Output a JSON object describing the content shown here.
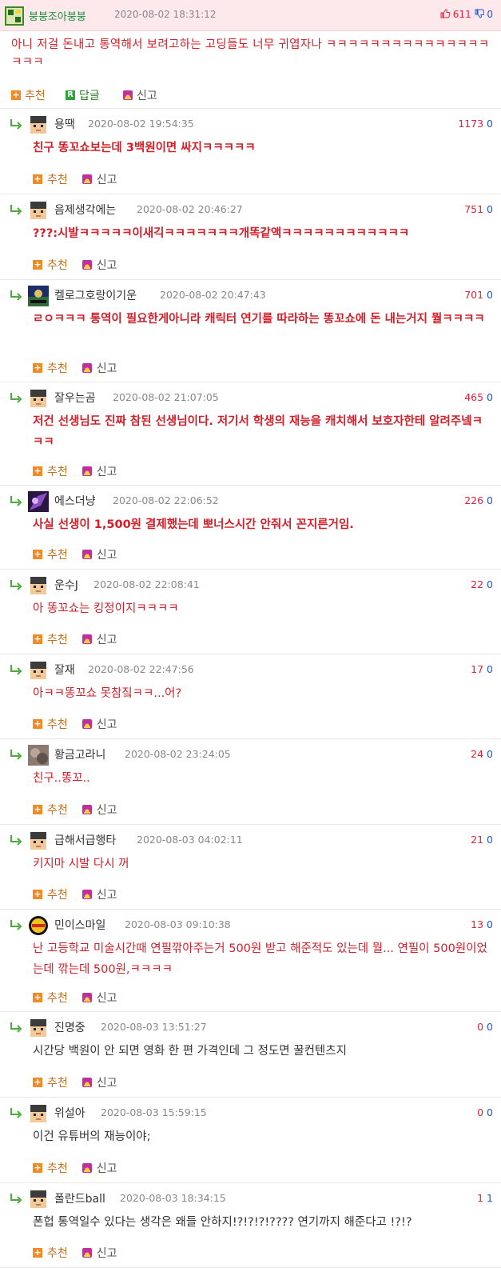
{
  "post": {
    "nickname": "붕붕조아붕붕",
    "date": "2020-08-02 18:31:12",
    "up": "611",
    "down": "0",
    "text": "아니 저걸 돈내고 통역해서 보려고하는 고딩들도 너무 귀엽자나 ㅋㅋㅋㅋㅋㅋㅋㅋㅋㅋㅋㅋㅋㅋㅋㅋㅋㅋ",
    "recommend_label": "추천",
    "reply_label": "답글",
    "report_label": "신고"
  },
  "replies": [
    {
      "nick": "용땍",
      "date": "2020-08-02 19:54:35",
      "up": "1173",
      "down": "0",
      "text": "친구 똥꼬쇼보는데 3백원이면 싸지ㅋㅋㅋㅋㅋ",
      "avatar": "default"
    },
    {
      "nick": "음제생각에는",
      "date": "2020-08-02 20:46:27",
      "up": "751",
      "down": "0",
      "text": "???:시발ㅋㅋㅋㅋㅋ이새긱ㅋㅋㅋㅋㅋㅋㅋ개똑같액ㅋㅋㅋㅋㅋㅋㅋㅋㅋㅋㅋㅋ",
      "avatar": "default"
    },
    {
      "nick": "켈로그호랑이기운",
      "date": "2020-08-02 20:47:43",
      "up": "701",
      "down": "0",
      "text": "ㄹㅇㅋㅋㅋ 통역이 필요한게아니라 캐릭터 연기를 따라하는 똥꼬쇼에 돈 내는거지 뭘ㅋㅋㅋㅋ",
      "avatar": "game"
    },
    {
      "nick": "잘우는곰",
      "date": "2020-08-02 21:07:05",
      "up": "465",
      "down": "0",
      "text": "저건 선생님도 진짜 참된 선생님이다. 저기서 학생의 재능을 캐치해서 보호자한테 알려주넼ㅋㅋㅋ",
      "avatar": "default"
    },
    {
      "nick": "에스더냥",
      "date": "2020-08-02 22:06:52",
      "up": "226",
      "down": "0",
      "text": "사실 선생이 1,500원 결제했는데 뽀너스시간 안줘서 꼰지른거임.",
      "avatar": "purple"
    },
    {
      "nick": "운수J",
      "date": "2020-08-02 22:08:41",
      "up": "22",
      "down": "0",
      "text": "아 똥꼬쇼는 킹정이지ㅋㅋㅋㅋ",
      "avatar": "default"
    },
    {
      "nick": "잘재",
      "date": "2020-08-02 22:47:56",
      "up": "17",
      "down": "0",
      "text": "아ㅋㅋ똥꼬쇼 못참짘ㅋㅋ...어?",
      "avatar": "default"
    },
    {
      "nick": "황금고라니",
      "date": "2020-08-02 23:24:05",
      "up": "24",
      "down": "0",
      "text": "친구..똥꼬..",
      "avatar": "photo"
    },
    {
      "nick": "급해서급행타",
      "date": "2020-08-03 04:02:11",
      "up": "21",
      "down": "0",
      "text": "키지마 시발 다시 꺼",
      "avatar": "default"
    },
    {
      "nick": "민이스마일",
      "date": "2020-08-03 09:10:38",
      "up": "13",
      "down": "0",
      "text": "난 고등학교 미술시간때 연필깎아주는거 500원 받고 해준적도 있는데 뭘... 연필이 500원이었는데 깎는데 500원,ㅋㅋㅋㅋ",
      "avatar": "logo"
    },
    {
      "nick": "진명중",
      "date": "2020-08-03 13:51:27",
      "up": "0",
      "down": "0",
      "text": "시간당 백원이 안 되면 영화 한 편 가격인데 그 정도면 꿀컨텐츠지",
      "avatar": "default"
    },
    {
      "nick": "위설아",
      "date": "2020-08-03 15:59:15",
      "up": "0",
      "down": "0",
      "text": "이건 유튜버의 재능이야;",
      "avatar": "default"
    },
    {
      "nick": "폴란드ball",
      "date": "2020-08-03 18:34:15",
      "up": "1",
      "down": "1",
      "text": "폰헙 통역일수 있다는 생각은 왜들 안하지!?!?!?!???? 연기까지 해준다고 !?!?",
      "avatar": "default"
    }
  ],
  "labels": {
    "recommend": "추천",
    "report": "신고"
  },
  "colors": {
    "red_text": "#d0202a",
    "up": "#e0213a",
    "down": "#1f56d6",
    "header_bg": "#fde8ec",
    "recommend": "#c8701b"
  }
}
